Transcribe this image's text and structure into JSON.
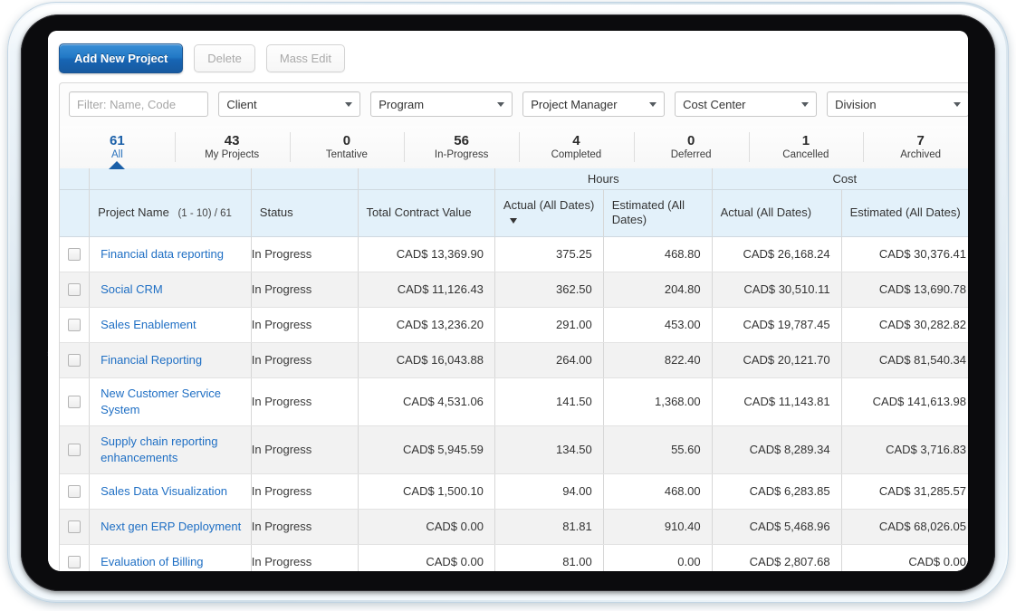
{
  "toolbar": {
    "add_label": "Add New Project",
    "delete_label": "Delete",
    "mass_edit_label": "Mass Edit"
  },
  "filters": {
    "search_placeholder": "Filter: Name, Code",
    "search_value": "",
    "client_label": "Client",
    "program_label": "Program",
    "project_manager_label": "Project Manager",
    "cost_center_label": "Cost Center",
    "division_label": "Division"
  },
  "stat_tabs": [
    {
      "count": "61",
      "label": "All",
      "active": true
    },
    {
      "count": "43",
      "label": "My Projects",
      "active": false
    },
    {
      "count": "0",
      "label": "Tentative",
      "active": false
    },
    {
      "count": "56",
      "label": "In-Progress",
      "active": false
    },
    {
      "count": "4",
      "label": "Completed",
      "active": false
    },
    {
      "count": "0",
      "label": "Deferred",
      "active": false
    },
    {
      "count": "1",
      "label": "Cancelled",
      "active": false
    },
    {
      "count": "7",
      "label": "Archived",
      "active": false
    }
  ],
  "table": {
    "group_headers": {
      "hours": "Hours",
      "cost": "Cost"
    },
    "headers": {
      "project_name": "Project Name",
      "project_name_range": "(1 - 10) / 61",
      "status": "Status",
      "total_contract_value": "Total Contract Value",
      "hours_actual": "Actual (All Dates)",
      "hours_estimated": "Estimated (All Dates)",
      "cost_actual": "Actual (All Dates)",
      "cost_estimated": "Estimated (All Dates)",
      "sort_column": "hours_actual",
      "sort_direction": "descending"
    },
    "rows": [
      {
        "name": "Financial data reporting",
        "status": "In Progress",
        "tcv": "CAD$ 13,369.90",
        "hours_actual": "375.25",
        "hours_estimated": "468.80",
        "cost_actual": "CAD$ 26,168.24",
        "cost_estimated": "CAD$ 30,376.41",
        "checked": false,
        "two_line": false
      },
      {
        "name": "Social CRM",
        "status": "In Progress",
        "tcv": "CAD$ 11,126.43",
        "hours_actual": "362.50",
        "hours_estimated": "204.80",
        "cost_actual": "CAD$ 30,510.11",
        "cost_estimated": "CAD$ 13,690.78",
        "checked": false,
        "two_line": false
      },
      {
        "name": "Sales Enablement",
        "status": "In Progress",
        "tcv": "CAD$ 13,236.20",
        "hours_actual": "291.00",
        "hours_estimated": "453.00",
        "cost_actual": "CAD$ 19,787.45",
        "cost_estimated": "CAD$ 30,282.82",
        "checked": false,
        "two_line": false
      },
      {
        "name": "Financial Reporting",
        "status": "In Progress",
        "tcv": "CAD$ 16,043.88",
        "hours_actual": "264.00",
        "hours_estimated": "822.40",
        "cost_actual": "CAD$ 20,121.70",
        "cost_estimated": "CAD$ 81,540.34",
        "checked": false,
        "two_line": false
      },
      {
        "name": "New Customer Service System",
        "status": "In Progress",
        "tcv": "CAD$ 4,531.06",
        "hours_actual": "141.50",
        "hours_estimated": "1,368.00",
        "cost_actual": "CAD$ 11,143.81",
        "cost_estimated": "CAD$ 141,613.98",
        "checked": false,
        "two_line": true
      },
      {
        "name": "Supply chain reporting enhancements",
        "status": "In Progress",
        "tcv": "CAD$ 5,945.59",
        "hours_actual": "134.50",
        "hours_estimated": "55.60",
        "cost_actual": "CAD$ 8,289.34",
        "cost_estimated": "CAD$ 3,716.83",
        "checked": false,
        "two_line": true
      },
      {
        "name": "Sales Data Visualization",
        "status": "In Progress",
        "tcv": "CAD$ 1,500.10",
        "hours_actual": "94.00",
        "hours_estimated": "468.00",
        "cost_actual": "CAD$ 6,283.85",
        "cost_estimated": "CAD$ 31,285.57",
        "checked": false,
        "two_line": false
      },
      {
        "name": "Next gen ERP Deployment",
        "status": "In Progress",
        "tcv": "CAD$ 0.00",
        "hours_actual": "81.81",
        "hours_estimated": "910.40",
        "cost_actual": "CAD$ 5,468.96",
        "cost_estimated": "CAD$ 68,026.05",
        "checked": false,
        "two_line": false
      },
      {
        "name": "Evaluation of Billing",
        "status": "In Progress",
        "tcv": "CAD$ 0.00",
        "hours_actual": "81.00",
        "hours_estimated": "0.00",
        "cost_actual": "CAD$ 2,807.68",
        "cost_estimated": "CAD$ 0.00",
        "checked": false,
        "two_line": false
      }
    ]
  },
  "colors": {
    "accent_blue": "#1f6fc4",
    "header_blue": "#e3f1fa",
    "active_tab": "#1a5fa8",
    "primary_button": "#1f72c0",
    "row_alt": "#f2f2f2",
    "bezel": "#0b0b0d"
  }
}
